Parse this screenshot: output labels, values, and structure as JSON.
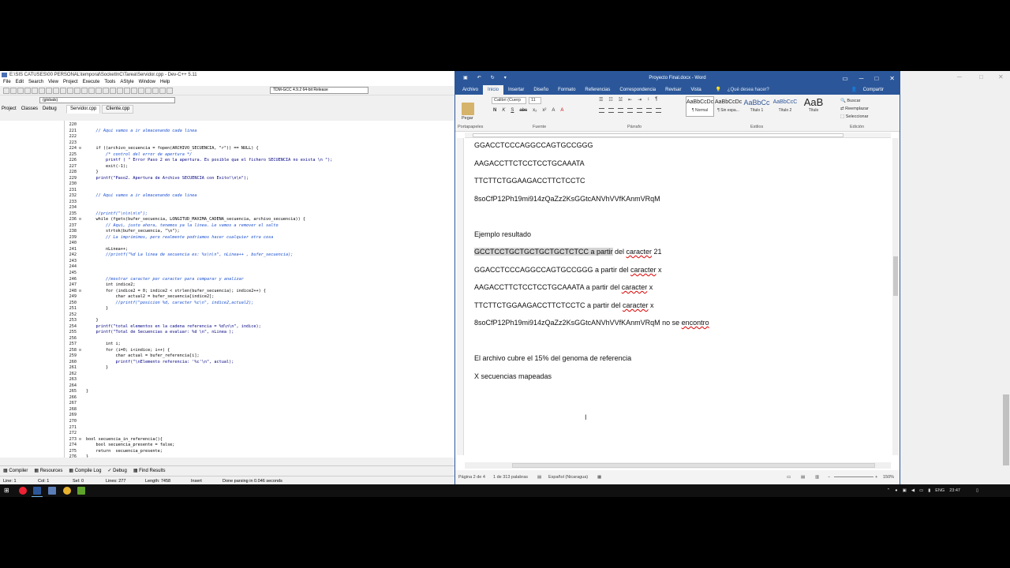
{
  "devcpp": {
    "title": "E:\\SIS CATUSES\\00 PERSONAL\\temporal\\SocketInC\\Tarea\\Servidor.cpp - Dev-C++ 5.11",
    "menu": [
      "File",
      "Edit",
      "Search",
      "View",
      "Project",
      "Execute",
      "Tools",
      "AStyle",
      "Window",
      "Help"
    ],
    "compiler": "TDM-GCC 4.9.2 64-bit Release",
    "globals": "(globals)",
    "left_tabs": [
      "Project",
      "Classes",
      "Debug"
    ],
    "file_tabs": [
      "Servidor.cpp",
      "Cliente.cpp"
    ],
    "bottom_tabs": [
      "Compiler",
      "Resources",
      "Compile Log",
      "Debug",
      "Find Results"
    ],
    "status": {
      "line": "Line:    1",
      "col": "Col:    1",
      "sel": "Sel:    0",
      "lines": "Lines:    277",
      "length": "Length:    7458",
      "mode": "Insert",
      "message": "Done parsing in 0.046 seconds"
    },
    "code_lines": [
      {
        "n": "220",
        "f": "",
        "c": "",
        "t": "tx"
      },
      {
        "n": "221",
        "f": "",
        "c": "    // Aqui vamos a ir almacenando cada linea",
        "t": "cm"
      },
      {
        "n": "222",
        "f": "",
        "c": "",
        "t": "tx"
      },
      {
        "n": "223",
        "f": "",
        "c": "",
        "t": "tx"
      },
      {
        "n": "224",
        "f": "⊟",
        "c": "    if ((archivo_secuencia = fopen(ARCHIVO_SECUENCIA, \"r\")) == NULL) {",
        "t": "tx"
      },
      {
        "n": "225",
        "f": "",
        "c": "        /* control del error de apertura */",
        "t": "cm"
      },
      {
        "n": "226",
        "f": "",
        "c": "        printf ( \" Error Paso 2 en la apertura. Es posible que el fichero SECUENCIA no exista \\n \");",
        "t": "str"
      },
      {
        "n": "227",
        "f": "",
        "c": "        exit(-1);",
        "t": "tx"
      },
      {
        "n": "228",
        "f": "",
        "c": "    }",
        "t": "tx"
      },
      {
        "n": "229",
        "f": "",
        "c": "    printf(\"Paso2. Apertura de Archivo SECUENCIA con Exito!\\n\\n\");",
        "t": "str"
      },
      {
        "n": "230",
        "f": "",
        "c": "",
        "t": "tx"
      },
      {
        "n": "231",
        "f": "",
        "c": "",
        "t": "tx"
      },
      {
        "n": "232",
        "f": "",
        "c": "    // Aqui vamos a ir almacenando cada linea",
        "t": "cm"
      },
      {
        "n": "233",
        "f": "",
        "c": "",
        "t": "tx"
      },
      {
        "n": "234",
        "f": "",
        "c": "",
        "t": "tx"
      },
      {
        "n": "235",
        "f": "",
        "c": "    //printf(\"\\n\\n\\n\\n\");",
        "t": "cm"
      },
      {
        "n": "236",
        "f": "⊟",
        "c": "    while (fgets(bufer_secuencia, LONGITUD_MAXIMA_CADENA_secuencia, archivo_secuencia)) {",
        "t": "tx"
      },
      {
        "n": "237",
        "f": "",
        "c": "        // Aqui, justo ahora, tenemos ya la linea. Le vamos a remover el salto",
        "t": "cm"
      },
      {
        "n": "238",
        "f": "",
        "c": "        strtok(bufer_secuencia, \"\\n\");",
        "t": "tx"
      },
      {
        "n": "239",
        "f": "",
        "c": "        // La imprimimos, pero realmente podriamos hacer cualquier otra cosa",
        "t": "cm"
      },
      {
        "n": "240",
        "f": "",
        "c": "",
        "t": "tx"
      },
      {
        "n": "241",
        "f": "",
        "c": "        nLinea++;",
        "t": "tx"
      },
      {
        "n": "242",
        "f": "",
        "c": "        //printf(\"%d La linea de secuencia es: %s\\n\\n\", nLinea++ , bufer_secuencia);",
        "t": "cm"
      },
      {
        "n": "243",
        "f": "",
        "c": "",
        "t": "tx"
      },
      {
        "n": "244",
        "f": "",
        "c": "",
        "t": "tx"
      },
      {
        "n": "245",
        "f": "",
        "c": "",
        "t": "tx"
      },
      {
        "n": "246",
        "f": "",
        "c": "        //mostrar caracter por caracter para comparar y analizar",
        "t": "cm"
      },
      {
        "n": "247",
        "f": "",
        "c": "        int indice2;",
        "t": "tx"
      },
      {
        "n": "248",
        "f": "⊟",
        "c": "        for (indice2 = 0; indice2 < strlen(bufer_secuencia); indice2++) {",
        "t": "tx"
      },
      {
        "n": "249",
        "f": "",
        "c": "            char actual2 = bufer_secuencia[indice2];",
        "t": "tx"
      },
      {
        "n": "250",
        "f": "",
        "c": "            //printf(\"posicion %d, caracter %c\\n\", indice2,actual2);",
        "t": "cm"
      },
      {
        "n": "251",
        "f": "",
        "c": "        }",
        "t": "tx"
      },
      {
        "n": "252",
        "f": "",
        "c": "",
        "t": "tx"
      },
      {
        "n": "253",
        "f": "",
        "c": "    }",
        "t": "tx"
      },
      {
        "n": "254",
        "f": "",
        "c": "    printf(\"total elementos en la cadena referencia = %d\\n\\n\", indice);",
        "t": "str"
      },
      {
        "n": "255",
        "f": "",
        "c": "    printf(\"Total de Secuencias a evaluar: %d \\n\", nLinea );",
        "t": "str"
      },
      {
        "n": "256",
        "f": "",
        "c": "",
        "t": "tx"
      },
      {
        "n": "257",
        "f": "",
        "c": "        int i;",
        "t": "tx"
      },
      {
        "n": "258",
        "f": "⊟",
        "c": "        for (i=0; i<indice; i++) {",
        "t": "tx"
      },
      {
        "n": "259",
        "f": "",
        "c": "            char actual = bufer_referencia[i];",
        "t": "tx"
      },
      {
        "n": "260",
        "f": "",
        "c": "            printf(\"\\nElemento referencia: '%c'\\n\", actual);",
        "t": "str"
      },
      {
        "n": "261",
        "f": "",
        "c": "        }",
        "t": "tx"
      },
      {
        "n": "262",
        "f": "",
        "c": "",
        "t": "tx"
      },
      {
        "n": "263",
        "f": "",
        "c": "",
        "t": "tx"
      },
      {
        "n": "264",
        "f": "",
        "c": "",
        "t": "tx"
      },
      {
        "n": "265",
        "f": "",
        "c": "}",
        "t": "tx"
      },
      {
        "n": "266",
        "f": "",
        "c": "",
        "t": "tx"
      },
      {
        "n": "267",
        "f": "",
        "c": "",
        "t": "tx"
      },
      {
        "n": "268",
        "f": "",
        "c": "",
        "t": "tx"
      },
      {
        "n": "269",
        "f": "",
        "c": "",
        "t": "tx"
      },
      {
        "n": "270",
        "f": "",
        "c": "",
        "t": "tx"
      },
      {
        "n": "271",
        "f": "",
        "c": "",
        "t": "tx"
      },
      {
        "n": "272",
        "f": "",
        "c": "",
        "t": "tx"
      },
      {
        "n": "273",
        "f": "⊟",
        "c": "bool secuencia_in_referencia(){",
        "t": "tx"
      },
      {
        "n": "274",
        "f": "",
        "c": "    bool secuencia_presente = false;",
        "t": "tx"
      },
      {
        "n": "275",
        "f": "",
        "c": "    return  secuencia_presente;",
        "t": "tx"
      },
      {
        "n": "276",
        "f": "",
        "c": "}",
        "t": "tx"
      },
      {
        "n": "277",
        "f": "",
        "c": "",
        "t": "tx"
      }
    ]
  },
  "word": {
    "title": "Proyecto Final.docx - Word",
    "tabs": [
      "Archivo",
      "Inicio",
      "Insertar",
      "Diseño",
      "Formato",
      "Referencias",
      "Correspondencia",
      "Revisar",
      "Vista"
    ],
    "tell_me": "¿Qué desea hacer?",
    "share": "Compartir",
    "ribbon": {
      "paste": "Pegar",
      "font": "Calibri (Cuerp",
      "size": "11",
      "groups": [
        "Portapapeles",
        "Fuente",
        "Párrafo",
        "Estilos",
        "Edición"
      ],
      "styles": [
        {
          "preview": "AaBbCcDc",
          "name": "¶ Normal"
        },
        {
          "preview": "AaBbCcDc",
          "name": "¶ Sin espa..."
        },
        {
          "preview": "AaBbCc",
          "name": "Título 1"
        },
        {
          "preview": "AaBbCcC",
          "name": "Título 2"
        },
        {
          "preview": "AaB",
          "name": "Título"
        }
      ],
      "editing": [
        "Buscar",
        "Reemplazar",
        "Seleccionar"
      ]
    },
    "doc_lines": {
      "l1": "GGACCTCCCAGGCCAGTGCCGGG",
      "l2": "AAGACCTTCTCCTCCTGCAAATA",
      "l3": "TTCTTCTGGAAGACCTTCTCCTC",
      "l4": "8soCfP12Ph19mi914zQaZz2KsGGtcANVhVVfKAnmVRqM",
      "heading": "Ejemplo resultado",
      "r1_hl": "GCCTCCTGCTGCTGCTGCTCTCC a partir",
      "r1_a": " del ",
      "r1_b": "caracter",
      "r1_c": " 21",
      "r2_a": "GGACCTCCCAGGCCAGTGCCGGG a partir del ",
      "r2_b": "caracter",
      "r2_c": " x",
      "r3_a": "AAGACCTTCTCCTCCTGCAAATA a partir del ",
      "r3_b": "caracter",
      "r3_c": " x",
      "r4_a": "TTCTTCTGGAAGACCTTCTCCTC a partir del ",
      "r4_b": "caracter",
      "r4_c": " x",
      "r5_a": "8soCfP12Ph19mi914zQaZz2KsGGtcANVhVVfKAnmVRqM no se ",
      "r5_b": "encontro",
      "cover": "El archivo cubre el 15% del genoma de referencia",
      "mapped": "X secuencias mapeadas"
    },
    "status": {
      "page": "Página 2 de 4",
      "words": "1 de 313 palabras",
      "lang": "Español (Nicaragua)",
      "zoom": "150%"
    }
  },
  "taskbar": {
    "lang": "ENG",
    "time": "23:47"
  },
  "colors": {
    "word_blue": "#2b579a",
    "comment_blue": "#1a4fd0"
  }
}
